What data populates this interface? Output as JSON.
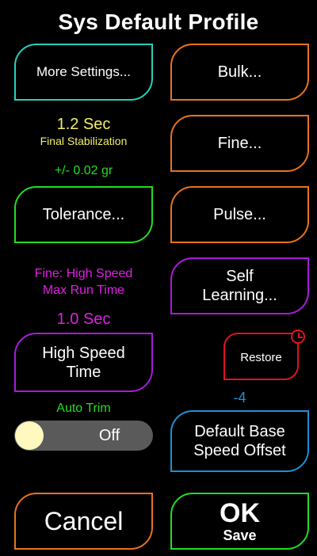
{
  "title": "Sys Default Profile",
  "left": {
    "more_settings": "More Settings...",
    "stabilization_value": "1.2 Sec",
    "stabilization_label": "Final Stabilization",
    "tolerance_value": "+/- 0.02 gr",
    "tolerance_button": "Tolerance...",
    "fine_label_line1": "Fine: High Speed",
    "fine_label_line2": "Max Run Time",
    "fine_value": "1.0 Sec",
    "high_speed_line1": "High Speed",
    "high_speed_line2": "Time",
    "auto_trim_label": "Auto Trim",
    "auto_trim_state": "Off",
    "cancel": "Cancel"
  },
  "right": {
    "bulk": "Bulk...",
    "fine": "Fine...",
    "pulse": "Pulse...",
    "self_line1": "Self",
    "self_line2": "Learning...",
    "restore": "Restore",
    "offset_value": "-4",
    "offset_line1": "Default Base",
    "offset_line2": "Speed Offset",
    "ok": "OK",
    "save": "Save"
  },
  "colors": {
    "green": "#22dd22",
    "orange": "#e8731c",
    "teal": "#22d3b8",
    "purple": "#aa1adb",
    "red": "#e0141e",
    "blue": "#1e90d6",
    "yellow": "#f3ef6a",
    "magenta": "#e21fe6"
  },
  "icons": {
    "restore": "clock-icon"
  }
}
